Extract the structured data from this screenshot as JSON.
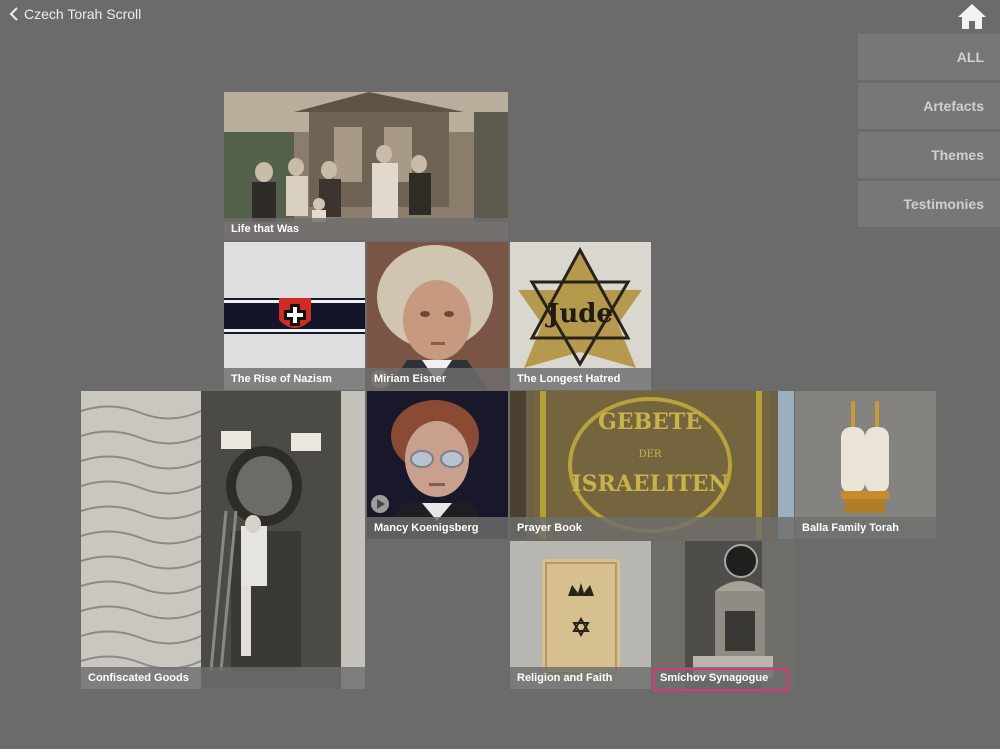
{
  "nav": {
    "back_label": "Czech Torah Scroll"
  },
  "filters": [
    "ALL",
    "Artefacts",
    "Themes",
    "Testimonies"
  ],
  "tiles": {
    "life": "Life that Was",
    "nazism": "The Rise of Nazism",
    "miriam": "Miriam Eisner",
    "hatred": "The Longest Hatred",
    "confiscated": "Confiscated Goods",
    "mancy": "Mancy Koenigsberg",
    "prayer": "Prayer Book",
    "balla": "Balla Family Torah",
    "religion": "Religion and Faith",
    "smichov": "Smíchov Synagogue"
  },
  "star_text": "Jude",
  "book_text": [
    "GEBETE",
    "DER",
    "ISRAELITEN"
  ],
  "selected_tile": "Smíchov Synagogue",
  "colors": {
    "background": "#6b6b6a",
    "filter_button": "#777776",
    "selection": "#e0357a"
  }
}
